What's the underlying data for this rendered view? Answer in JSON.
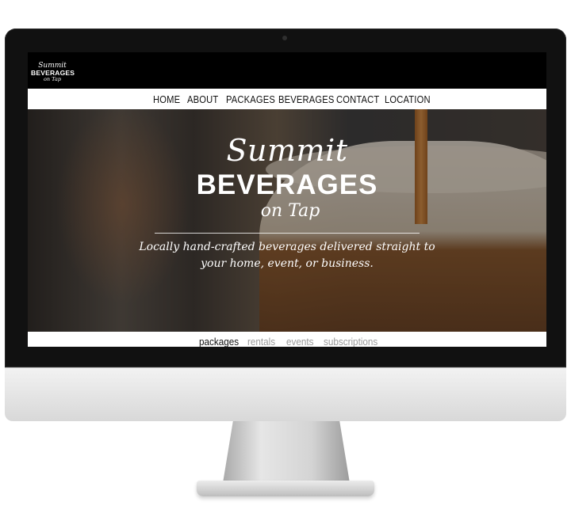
{
  "logo": {
    "line1": "Summit",
    "line2": "BEVERAGES",
    "line3": "on Tap"
  },
  "nav": {
    "items": [
      "HOME",
      "ABOUT",
      "PACKAGES",
      "BEVERAGES",
      "CONTACT",
      "LOCATION"
    ]
  },
  "hero": {
    "title_script": "Summit",
    "title_main": "BEVERAGES",
    "title_sub": "on Tap",
    "tagline_line1": "Locally hand-crafted beverages delivered straight to",
    "tagline_line2": "your home, event, or business."
  },
  "subnav": {
    "items": [
      "packages",
      "rentals",
      "events",
      "subscriptions"
    ],
    "active": "packages"
  },
  "colors": {
    "topbar": "#000000",
    "monitor_bezel": "#111111",
    "inactive_subnav": "#9a9a9a"
  }
}
